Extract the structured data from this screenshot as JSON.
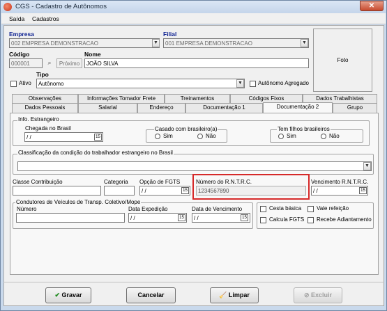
{
  "window": {
    "title": "CGS - Cadastro de Autônomos",
    "close": "✕"
  },
  "menu": [
    "Saída",
    "Cadastros"
  ],
  "empresa": {
    "label": "Empresa",
    "value": "002 EMPRESA DEMONSTRACAO"
  },
  "filial": {
    "label": "Filial",
    "value": "001 EMPRESA DEMONSTRACAO"
  },
  "codigo": {
    "label": "Código",
    "value": "000001",
    "proximo": "Próximo"
  },
  "nome": {
    "label": "Nome",
    "value": "JOÃO SILVA"
  },
  "foto": "Foto",
  "ativo": "Ativo",
  "tipo": {
    "label": "Tipo",
    "value": "Autônomo"
  },
  "autonomo_agregado": "Autônomo Agregado",
  "tabs_row1": [
    "Observações",
    "Informações Tomador Frete",
    "Treinamentos",
    "Códigos Fixos",
    "Dados Trabalhistas"
  ],
  "tabs_row2": [
    "Dados Pessoais",
    "Salarial",
    "Endereço",
    "Documentação 1",
    "Documentação 2",
    "Grupo"
  ],
  "info_estrangeiro": {
    "title": "Info. Estrangeiro",
    "chegada_label": "Chegada no Brasil",
    "chegada_value": " / /",
    "casado_label": "Casado com brasileiro(a)",
    "filhos_label": "Tem filhos brasileiros",
    "sim": "Sim",
    "nao": "Não"
  },
  "classificacao": {
    "label": "Classificação da condição do trabalhador estrangeiro no Brasil",
    "value": ""
  },
  "classe_contribuicao": {
    "label": "Classe Contribuição",
    "value": ""
  },
  "categoria": {
    "label": "Categoria",
    "value": ""
  },
  "opcao_fgts": {
    "label": "Opção de FGTS",
    "value": " / /"
  },
  "rntrc": {
    "label": "Número do R.N.T.R.C.",
    "value": "1234567890"
  },
  "vencimento_rntrc": {
    "label": "Vencimento R.N.T.R.C.",
    "value": " / /"
  },
  "condutores": {
    "title": "Condutores de Veículos de Transp. Coletivo/Mope",
    "numero_label": "Número",
    "numero_value": "",
    "expedicao_label": "Data Expedição",
    "expedicao_value": " / /",
    "vencimento_label": "Data de Vencimento",
    "vencimento_value": " / /"
  },
  "checks": {
    "cesta_basica": "Cesta básica",
    "vale_refeicao": "Vale refeição",
    "calcula_fgts": "Calcula FGTS",
    "recebe_adiantamento": "Recebe Adiantamento"
  },
  "buttons": {
    "gravar": "Gravar",
    "cancelar": "Cancelar",
    "limpar": "Limpar",
    "excluir": "Excluir"
  },
  "colors": {
    "highlight": "#d62a2a",
    "label_blue": "#0a1e90"
  }
}
